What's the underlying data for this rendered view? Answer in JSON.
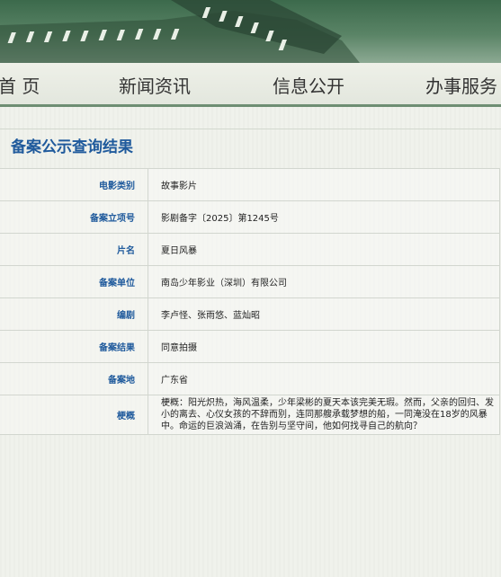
{
  "nav": {
    "items": [
      {
        "label": "首 页"
      },
      {
        "label": "新闻资讯"
      },
      {
        "label": "信息公开"
      },
      {
        "label": "办事服务"
      }
    ]
  },
  "page": {
    "title": "备案公示查询结果"
  },
  "record": {
    "rows": [
      {
        "label": "电影类别",
        "value": "故事影片"
      },
      {
        "label": "备案立项号",
        "value": "影剧备字〔2025〕第1245号"
      },
      {
        "label": "片名",
        "value": "夏日风暴"
      },
      {
        "label": "备案单位",
        "value": "南岛少年影业（深圳）有限公司"
      },
      {
        "label": "编剧",
        "value": "李卢怪、张雨悠、蓝灿昭"
      },
      {
        "label": "备案结果",
        "value": "同意拍摄"
      },
      {
        "label": "备案地",
        "value": "广东省"
      },
      {
        "label": "梗概",
        "value": "梗概：阳光炽热，海风温柔，少年梁彬的夏天本该完美无瑕。然而，父亲的回归、发小的离去、心仪女孩的不辞而别，连同那艘承载梦想的船，一同淹没在18岁的风暴中。命运的巨浪汹涌，在告别与坚守间，他如何找寻自己的航向？"
      }
    ]
  },
  "colors": {
    "accent": "#1f5a9c",
    "nav_border": "#6e8e73",
    "banner": "#3c6a4c"
  }
}
